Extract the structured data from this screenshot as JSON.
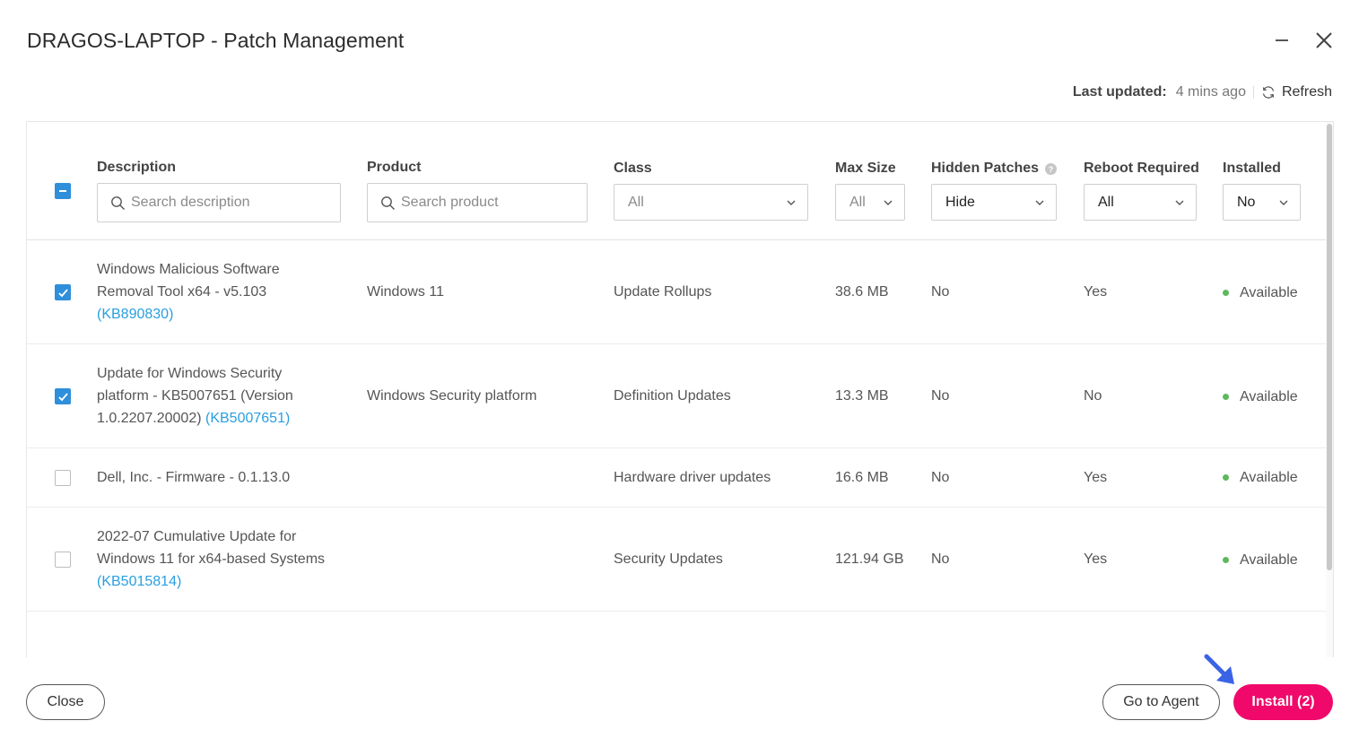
{
  "dialog": {
    "title": "DRAGOS-LAPTOP - Patch Management"
  },
  "status_bar": {
    "last_updated_label": "Last updated:",
    "last_updated_value": "4 mins ago",
    "refresh_label": "Refresh"
  },
  "columns": {
    "description": "Description",
    "product": "Product",
    "class": "Class",
    "max_size": "Max Size",
    "hidden_patches": "Hidden Patches",
    "reboot_required": "Reboot Required",
    "installed": "Installed"
  },
  "filters": {
    "description_placeholder": "Search description",
    "product_placeholder": "Search product",
    "class_value": "All",
    "max_size_value": "All",
    "hidden_patches_value": "Hide",
    "reboot_required_value": "All",
    "installed_value": "No"
  },
  "rows": [
    {
      "checked": true,
      "description_lines": [
        "Windows Malicious Software",
        "Removal Tool x64 - v5.103"
      ],
      "kb": "(KB890830)",
      "product": "Windows 11",
      "class": "Update Rollups",
      "max_size": "38.6 MB",
      "hidden": "No",
      "reboot": "Yes",
      "installed": "Available"
    },
    {
      "checked": true,
      "description_lines": [
        "Update for Windows Security",
        "platform - KB5007651 (Version",
        "1.0.2207.20002)"
      ],
      "kb": "(KB5007651)",
      "product": "Windows Security platform",
      "class": "Definition Updates",
      "max_size": "13.3 MB",
      "hidden": "No",
      "reboot": "No",
      "installed": "Available"
    },
    {
      "checked": false,
      "description_lines": [
        "Dell, Inc. - Firmware - 0.1.13.0"
      ],
      "kb": "",
      "product": "",
      "class": "Hardware driver updates",
      "max_size": "16.6 MB",
      "hidden": "No",
      "reboot": "Yes",
      "installed": "Available"
    },
    {
      "checked": false,
      "description_lines": [
        "2022-07 Cumulative Update for",
        "Windows 11 for x64-based Systems"
      ],
      "kb": "(KB5015814)",
      "product": "",
      "class": "Security Updates",
      "max_size": "121.94 GB",
      "hidden": "No",
      "reboot": "Yes",
      "installed": "Available"
    }
  ],
  "footer": {
    "close_label": "Close",
    "go_to_agent_label": "Go to Agent",
    "install_label": "Install (2)"
  },
  "colors": {
    "accent_blue": "#2f8fdb",
    "link_blue": "#2a9fe0",
    "install_pink": "#f0086a",
    "available_green": "#5cb85c",
    "annotation_arrow": "#3b63e6"
  },
  "icons": {
    "minimize": "minimize-icon",
    "close": "close-icon",
    "refresh": "refresh-icon",
    "search": "search-icon",
    "chevron": "chevron-down-icon",
    "help": "help-circle-icon",
    "check": "check-icon"
  }
}
